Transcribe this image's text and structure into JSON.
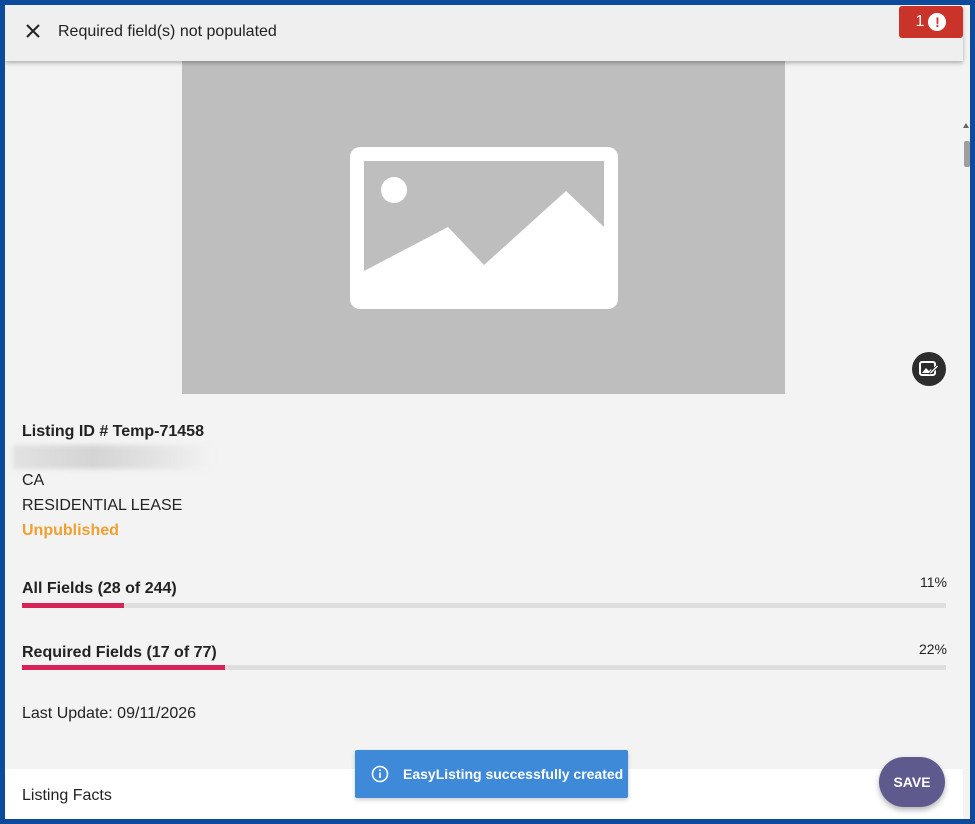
{
  "header": {
    "title": "Required field(s) not populated",
    "error_count": "1",
    "close_icon": "close-icon",
    "alert_icon": "exclamation-circle-icon",
    "error_color": "#c9332a"
  },
  "photo": {
    "placeholder_icon": "image-placeholder-icon",
    "edit_icon": "edit-photo-icon"
  },
  "listing": {
    "id_label": "Listing ID # Temp-71458",
    "state": "CA",
    "property_type": "RESIDENTIAL LEASE",
    "status": "Unpublished",
    "status_color": "#f0a030"
  },
  "progress": {
    "all_fields": {
      "label": "All Fields (28 of 244)",
      "percent_text": "11%",
      "fraction": 0.11
    },
    "required_fields": {
      "label": "Required Fields (17 of 77)",
      "percent_text": "22%",
      "fraction": 0.22
    },
    "bar_color": "#d6245a"
  },
  "last_update": "Last Update: 09/11/2026",
  "section": {
    "listing_facts": "Listing Facts"
  },
  "toast": {
    "message": "EasyListing successfully created",
    "icon": "info-icon",
    "color": "#3f8ad8"
  },
  "actions": {
    "save_label": "SAVE",
    "save_color": "#5e5a8e"
  }
}
